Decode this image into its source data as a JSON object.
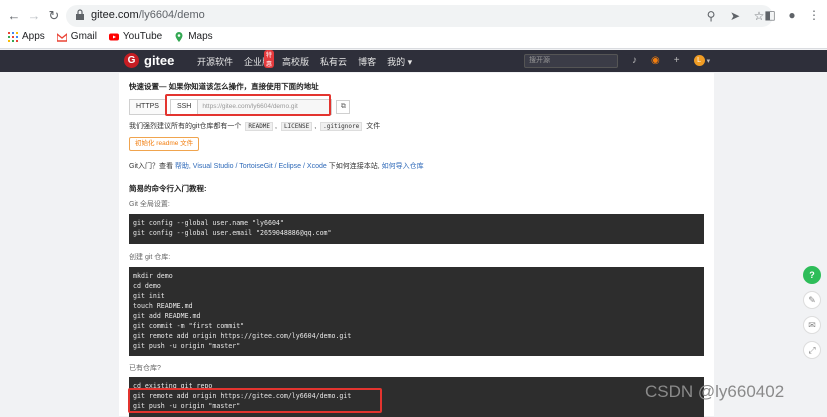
{
  "browser": {
    "url_host": "gitee.com",
    "url_path": "/ly6604/demo",
    "nav": {
      "back": "←",
      "forward": "→",
      "reload": "↻"
    },
    "omnibox_icons": [
      "search-icon",
      "share-icon",
      "star-icon"
    ],
    "toolbar_icons": [
      "sidepanel-icon",
      "profile-icon",
      "menu-icon"
    ],
    "bookmarks": [
      {
        "label": "Apps",
        "icon": "apps-grid-icon"
      },
      {
        "label": "Gmail",
        "icon": "gmail-icon"
      },
      {
        "label": "YouTube",
        "icon": "youtube-icon"
      },
      {
        "label": "Maps",
        "icon": "maps-icon"
      }
    ]
  },
  "gitee_nav": {
    "logo_text": "gitee",
    "logo_mark": "G",
    "items": [
      "开源软件",
      "企业版",
      "高校版",
      "私有云",
      "博客",
      "我的"
    ],
    "badge": "特惠",
    "search_placeholder": "搜开源",
    "avatar_letter": "L"
  },
  "page": {
    "quick_setup": "快速设置— 如果你知道该怎么操作，直接使用下面的地址",
    "https_label": "HTTPS",
    "ssh_label": "SSH",
    "repo_url": "https://gitee.com/ly6604/demo.git",
    "copy_glyph": "⧉",
    "recommend_prefix": "我们强烈建议所有的git仓库都有一个",
    "readme_tag": "README",
    "license_tag": "LICENSE",
    "gitignore_tag": ".gitignore",
    "recommend_suffix": "文件",
    "init_button": "初始化 readme 文件",
    "git_intro_prefix": "Git入门？查看 ",
    "git_help_link": "帮助",
    "git_tools": ", Visual Studio / TortoiseGit / Eclipse / Xcode",
    "git_connect": " 下如何连接本站,",
    "git_import_link": " 如何导入仓库",
    "tutorial_heading": "简易的命令行入门教程:",
    "global_setup_label": "Git 全局设置:",
    "global_setup_code": "git config --global user.name \"ly6604\"\ngit config --global user.email \"2659048886@qq.com\"",
    "create_repo_label": "创建 git 仓库:",
    "create_repo_code": "mkdir demo\ncd demo\ngit init\ntouch README.md\ngit add README.md\ngit commit -m \"first commit\"\ngit remote add origin https://gitee.com/ly6604/demo.git\ngit push -u origin \"master\"",
    "existing_repo_label": "已有仓库?",
    "existing_repo_code": "cd existing_git_repo\ngit remote add origin https://gitee.com/ly6604/demo.git\ngit push -u origin \"master\""
  },
  "floaters": [
    "help-icon",
    "edit-icon",
    "comment-icon",
    "expand-icon"
  ],
  "watermark": "CSDN @ly660402",
  "colors": {
    "highlight_box": "#e3342f",
    "gitee_red": "#c71d23",
    "nav_bg": "#2e2f3a"
  }
}
